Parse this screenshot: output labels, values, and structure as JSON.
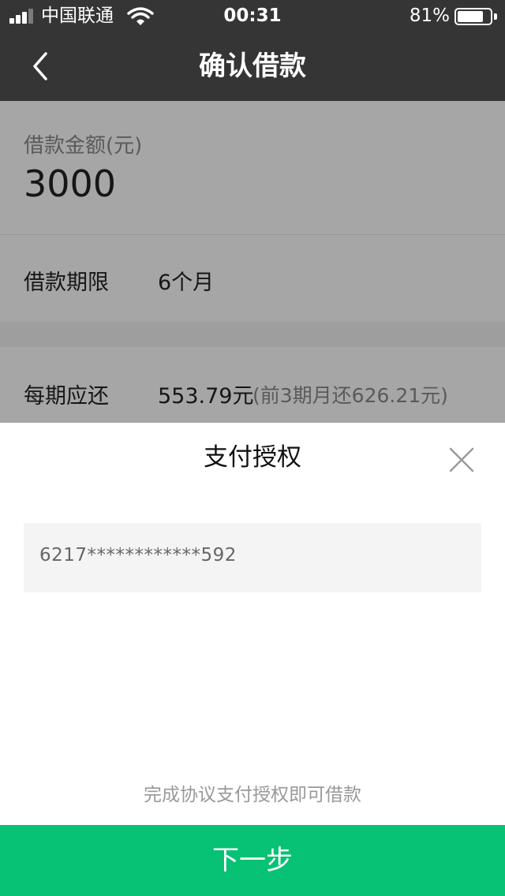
{
  "status_bar": {
    "carrier": "中国联通",
    "time": "00:31",
    "battery": "81%",
    "battery_level": 0.81,
    "icons": [
      "signal-icon",
      "wifi-icon",
      "battery-icon"
    ]
  },
  "nav": {
    "title": "确认借款",
    "back_icon": "chevron-left-icon"
  },
  "loan": {
    "amount_label": "借款金额(元)",
    "amount_value": "3000",
    "term_label": "借款期限",
    "term_value": "6个月",
    "repay_label": "每期应还",
    "repay_value": "553.79元",
    "repay_note": "(前3期月还626.21元)"
  },
  "sheet": {
    "title": "支付授权",
    "close_icon": "close-icon",
    "card_number": "6217************592",
    "hint": "完成协议支付授权即可借款",
    "next_label": "下一步"
  },
  "colors": {
    "header_bg": "#353535",
    "accent_green": "#07c174",
    "overlay": "rgba(0,0,0,0.35)"
  }
}
